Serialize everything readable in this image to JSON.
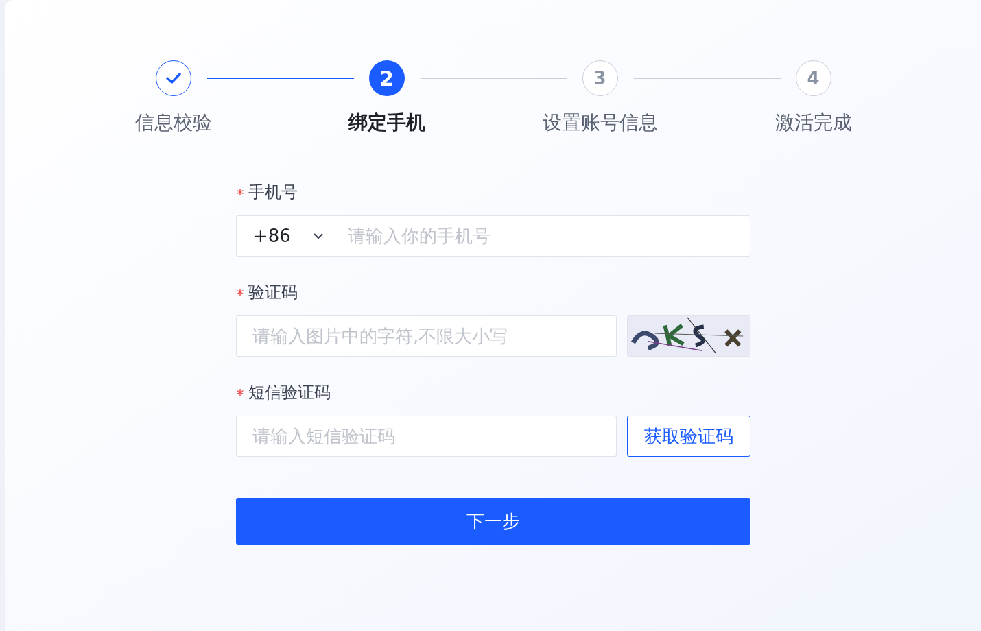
{
  "steps": [
    {
      "label": "信息校验",
      "completed": true,
      "selected": false
    },
    {
      "number": "2",
      "label": "绑定手机",
      "completed": false,
      "selected": true
    },
    {
      "number": "3",
      "label": "设置账号信息",
      "completed": false,
      "selected": false
    },
    {
      "number": "4",
      "label": "激活完成",
      "completed": false,
      "selected": false
    }
  ],
  "form": {
    "fields": [
      {
        "kind": "phone",
        "label": "手机号",
        "required": true,
        "country_code": "+86",
        "placeholder": "请输入你的手机号"
      },
      {
        "kind": "captcha",
        "label": "验证码",
        "required": true,
        "placeholder": "请输入图片中的字符,不限大小写"
      },
      {
        "kind": "sms",
        "label": "短信验证码",
        "required": true,
        "placeholder": "请输入短信验证码",
        "button": "获取验证码"
      }
    ],
    "submit": "下一步"
  }
}
